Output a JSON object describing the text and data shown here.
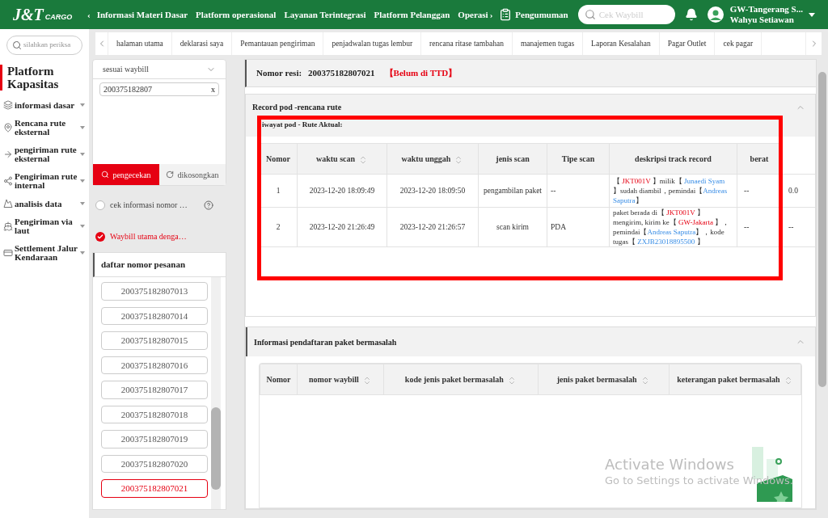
{
  "header": {
    "logo": "J&T",
    "logo_sub": "CARGO",
    "nav_prev": "‹",
    "nav": [
      "Informasi Materi Dasar",
      "Platform operasional",
      "Layanan Terintegrasi",
      "Platform Pelanggan",
      "Operasi"
    ],
    "nav_next": "›",
    "announcement": "Pengumuman",
    "search": {
      "placeholder": "Cek Waybill"
    },
    "user": {
      "branch": "GW-Tangerang S...",
      "name": "Wahyu Setiawan"
    }
  },
  "sidebar": {
    "search": {
      "placeholder": "silahkan periksa"
    },
    "title": "Platform Kapasitas",
    "items": [
      {
        "label": "informasi dasar",
        "kind": "layers"
      },
      {
        "label": "Rencana rute eksternal",
        "kind": "pin"
      },
      {
        "label": "pengiriman rute eksternal",
        "kind": "arrow"
      },
      {
        "label": "Pengiriman rute internal",
        "kind": "branch"
      },
      {
        "label": "analisis data",
        "kind": "chart"
      },
      {
        "label": "Pengiriman via laut",
        "kind": "ship"
      },
      {
        "label": "Settlement Jalur Kendaraan",
        "kind": "card"
      }
    ]
  },
  "tabs": {
    "items": [
      {
        "label": "halaman utama",
        "selected": false
      },
      {
        "label": "deklarasi saya",
        "selected": false
      },
      {
        "label": "Pemantauan pengiriman",
        "selected": false
      },
      {
        "label": "penjadwalan tugas lembur",
        "selected": false
      },
      {
        "label": "rencana ritase tambahan",
        "selected": false
      },
      {
        "label": "manajemen tugas",
        "selected": false
      },
      {
        "label": "Laporan Kesalahan",
        "selected": false
      },
      {
        "label": "Pagar Outlet",
        "selected": false
      },
      {
        "label": "cek pagar",
        "selected": false
      }
    ]
  },
  "filter": {
    "select": "sesuai waybill",
    "input": "200375182807",
    "clear": "x",
    "buttons": [
      {
        "label": "pengecekan",
        "selected": true
      },
      {
        "label": "dikosongkan",
        "selected": false
      }
    ],
    "options": [
      {
        "label": "cek informasi nomor …",
        "selected": false,
        "help": true
      },
      {
        "label": "Waybill utama denga…",
        "selected": true,
        "help": false
      }
    ],
    "list_title": "daftar nomor pesanan",
    "list": [
      {
        "label": "200375182807013",
        "selected": false
      },
      {
        "label": "200375182807014",
        "selected": false
      },
      {
        "label": "200375182807015",
        "selected": false
      },
      {
        "label": "200375182807016",
        "selected": false
      },
      {
        "label": "200375182807017",
        "selected": false
      },
      {
        "label": "200375182807018",
        "selected": false
      },
      {
        "label": "200375182807019",
        "selected": false
      },
      {
        "label": "200375182807020",
        "selected": false
      },
      {
        "label": "200375182807021",
        "selected": true
      }
    ]
  },
  "resi": {
    "label": "Nomor resi:",
    "value": "200375182807021",
    "status": "【Belum di TTD】"
  },
  "section_pod": {
    "title": "Record pod -rencana rute",
    "expanded": true,
    "subtitle": "iwayat pod - Rute Aktual:",
    "columns": [
      {
        "label": "Nomor",
        "sortable": false
      },
      {
        "label": "waktu scan",
        "sortable": true
      },
      {
        "label": "waktu unggah",
        "sortable": true
      },
      {
        "label": "jenis scan",
        "sortable": false
      },
      {
        "label": "Tipe scan",
        "sortable": false
      },
      {
        "label": "deskripsi track record",
        "sortable": false
      },
      {
        "label": "berat",
        "sortable": false
      }
    ],
    "rows": [
      {
        "cells": [
          "1",
          "2023-12-20 18:09:49",
          "2023-12-20 18:09:50",
          "pengambilan paket",
          "--"
        ],
        "description": [
          {
            "kind": "plain",
            "text": "【 "
          },
          {
            "kind": "code",
            "text": "JKT001V"
          },
          {
            "kind": "plain",
            "text": " 】milik【 "
          },
          {
            "kind": "link",
            "text": "Junaedi Syam"
          },
          {
            "kind": "plain",
            "text": " 】sudah diambil，pemindai【"
          },
          {
            "kind": "link",
            "text": "Andreas Saputra"
          },
          {
            "kind": "plain",
            "text": "】"
          }
        ],
        "tail": [
          "--",
          "0.0"
        ]
      },
      {
        "cells": [
          "2",
          "2023-12-20 21:26:49",
          "2023-12-20 21:26:57",
          "scan kirim",
          "PDA"
        ],
        "description": [
          {
            "kind": "plain",
            "text": "paket berada di【 "
          },
          {
            "kind": "code",
            "text": "JKT001V"
          },
          {
            "kind": "plain",
            "text": " 】mengirim, kirim ke【 "
          },
          {
            "kind": "code",
            "text": "GW-Jakarta"
          },
          {
            "kind": "plain",
            "text": " 】，pemindai【"
          },
          {
            "kind": "link",
            "text": "Andreas Saputra"
          },
          {
            "kind": "plain",
            "text": "】，kode tugas【 "
          },
          {
            "kind": "link",
            "text": "ZXJB23018895500"
          },
          {
            "kind": "plain",
            "text": " 】"
          }
        ],
        "tail": [
          "--",
          "--"
        ]
      }
    ]
  },
  "section_problem": {
    "title": "Informasi pendaftaran paket bermasalah",
    "expanded": true,
    "columns": [
      {
        "label": "Nomor",
        "sortable": false
      },
      {
        "label": "nomor waybill",
        "sortable": true
      },
      {
        "label": "kode jenis paket bermasalah",
        "sortable": true
      },
      {
        "label": "jenis paket bermasalah",
        "sortable": true
      },
      {
        "label": "keterangan paket bermasalah",
        "sortable": true
      }
    ]
  },
  "os_notice": {
    "title": "Activate Windows",
    "text": "Go to Settings to activate Windows."
  }
}
